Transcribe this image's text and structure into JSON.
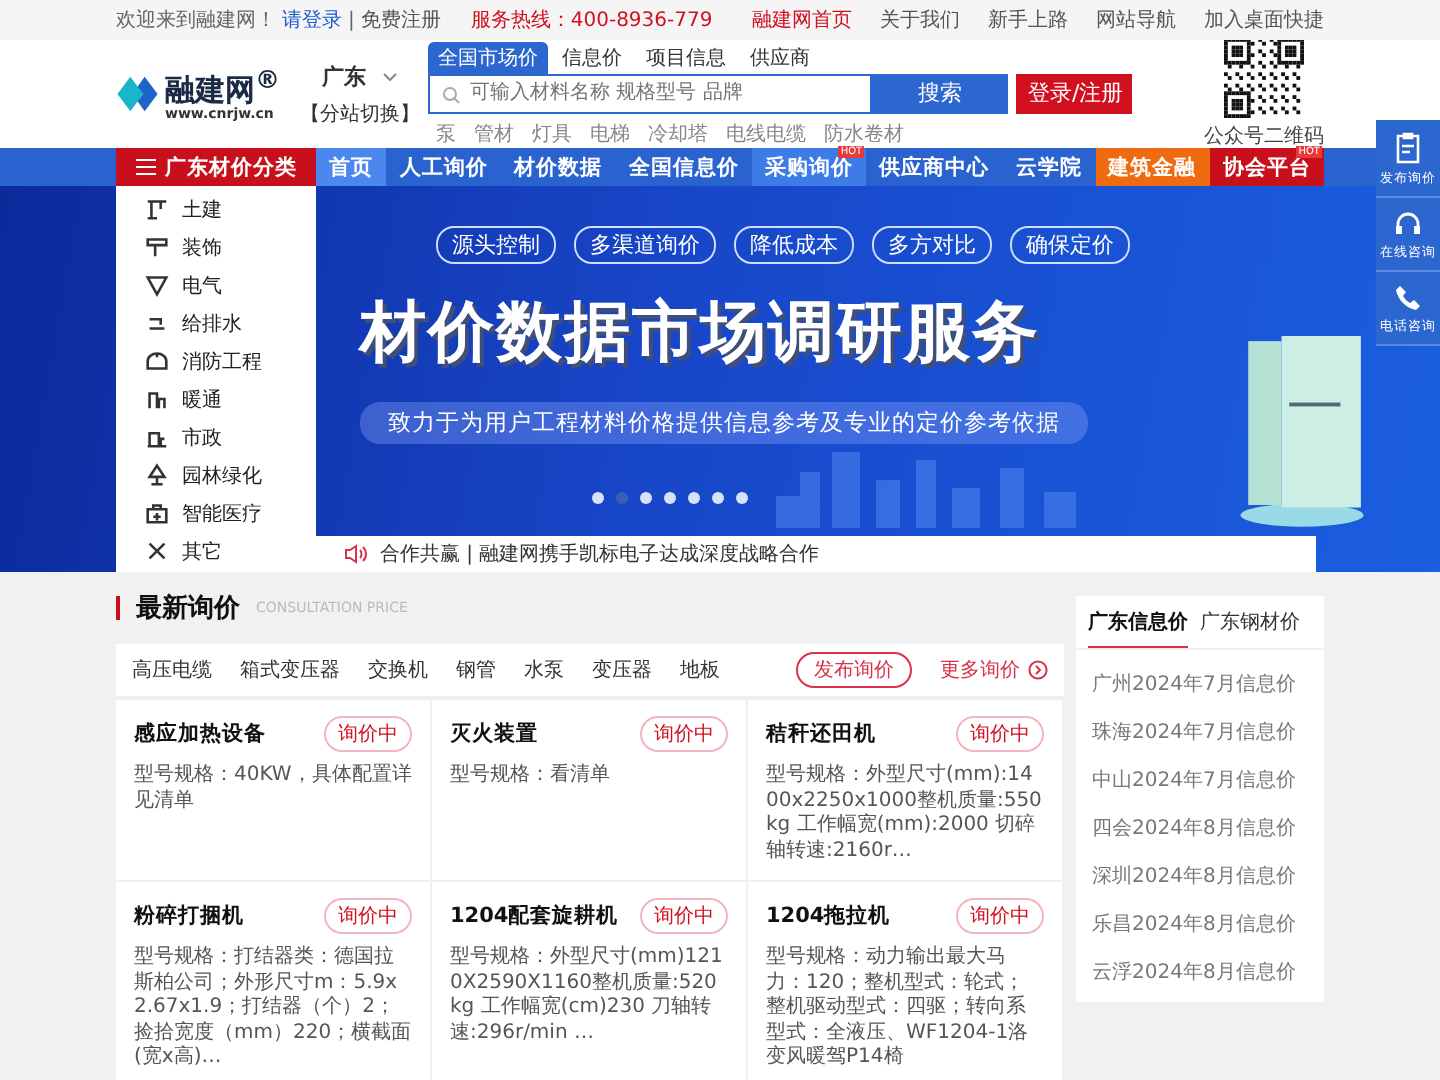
{
  "top_bar": {
    "welcome": "欢迎来到融建网！",
    "login_link": "请登录",
    "separator": "|",
    "register_link": "免费注册",
    "hotline": "服务热线：400-8936-779",
    "links": [
      {
        "label": "融建网首页",
        "selected": true
      },
      {
        "label": "关于我们",
        "selected": false
      },
      {
        "label": "新手上路",
        "selected": false
      },
      {
        "label": "网站导航",
        "selected": false
      },
      {
        "label": "加入桌面快捷",
        "selected": false
      }
    ]
  },
  "header": {
    "logo_name": "融建网$^{®}$",
    "logo_url": "www.cnrjw.cn",
    "city": "广东",
    "city_switch": "【分站切换】",
    "search_tabs": [
      {
        "label": "全国市场价",
        "selected": true
      },
      {
        "label": "信息价",
        "selected": false
      },
      {
        "label": "项目信息",
        "selected": false
      },
      {
        "label": "供应商",
        "selected": false
      }
    ],
    "search": {
      "placeholder": "可输入材料名称 规格型号 品牌"
    },
    "search_button": "搜索",
    "login_button": "登录/注册",
    "hot_keywords": [
      "泵",
      "管材",
      "灯具",
      "电梯",
      "冷却塔",
      "电线电缆",
      "防水卷材"
    ],
    "qr_caption": "公众号二维码"
  },
  "nav": {
    "category_button": "广东材价分类",
    "items": [
      {
        "label": "首页",
        "kind": "plain",
        "selected": true
      },
      {
        "label": "人工询价",
        "kind": "plain",
        "selected": false
      },
      {
        "label": "材价数据",
        "kind": "plain",
        "selected": false
      },
      {
        "label": "全国信息价",
        "kind": "plain",
        "selected": false
      },
      {
        "label": "采购询价",
        "kind": "light",
        "selected": false,
        "badge": "HOT"
      },
      {
        "label": "供应商中心",
        "kind": "plain",
        "selected": false
      },
      {
        "label": "云学院",
        "kind": "plain",
        "selected": false
      },
      {
        "label": "建筑金融",
        "kind": "orange",
        "selected": false
      },
      {
        "label": "协会平台",
        "kind": "red",
        "selected": false,
        "badge": "HOT"
      }
    ]
  },
  "sidebar": {
    "items": [
      "土建",
      "装饰",
      "电气",
      "给排水",
      "消防工程",
      "暖通",
      "市政",
      "园林绿化",
      "智能医疗",
      "其它"
    ]
  },
  "banner": {
    "pills": [
      "源头控制",
      "多渠道询价",
      "降低成本",
      "多方对比",
      "确保定价"
    ],
    "title": "材价数据市场调研服务",
    "subtitle": "致力于为用户工程材料价格提供信息参考及专业的定价参考依据",
    "dots": [
      {
        "selected": false
      },
      {
        "selected": true
      },
      {
        "selected": false
      },
      {
        "selected": false
      },
      {
        "selected": false
      },
      {
        "selected": false
      },
      {
        "selected": false
      }
    ]
  },
  "notice": {
    "text": "合作共赢 | 融建网携手凯标电子达成深度战略合作"
  },
  "inquiry": {
    "title": "最新询价",
    "subtitle": "CONSULTATION PRICE",
    "categories": [
      "高压电缆",
      "箱式变压器",
      "交换机",
      "钢管",
      "水泵",
      "变压器",
      "地板"
    ],
    "publish_button": "发布询价",
    "more_link": "更多询价",
    "items": [
      {
        "name": "感应加热设备",
        "status": "询价中",
        "spec": "型号规格：40KW，具体配置详见清单"
      },
      {
        "name": "灭火装置",
        "status": "询价中",
        "spec": "型号规格：看清单"
      },
      {
        "name": "秸秆还田机",
        "status": "询价中",
        "spec": "型号规格：外型尺寸(mm):1400x2250x1000整机质量:550 kg 工作幅宽(mm):2000 切碎轴转速:2160r…"
      },
      {
        "name": "粉碎打捆机",
        "status": "询价中",
        "spec": "型号规格：打结器类：德国拉斯柏公司；外形尺寸m：5.9x2.67x1.9；打结器（个）2；捡拾宽度（mm）220；横截面(宽x高)…"
      },
      {
        "name": "1204配套旋耕机",
        "status": "询价中",
        "spec": "型号规格：外型尺寸(mm)1210X2590X1160整机质量:520kg 工作幅宽(cm)230 刀轴转速:296r/min …"
      },
      {
        "name": "1204拖拉机",
        "status": "询价中",
        "spec": "型号规格：动力输出最大马力：120；整机型式：轮式；整机驱动型式：四驱；转向系型式：全液压、WF1204-1洛变风暖驾P14椅"
      }
    ]
  },
  "info_prices": {
    "tabs": [
      {
        "label": "广东信息价",
        "selected": true
      },
      {
        "label": "广东钢材价",
        "selected": false
      }
    ],
    "items": [
      "广州2024年7月信息价",
      "珠海2024年7月信息价",
      "中山2024年7月信息价",
      "四会2024年8月信息价",
      "深圳2024年8月信息价",
      "乐昌2024年8月信息价",
      "云浮2024年8月信息价"
    ]
  },
  "float_bar": {
    "buttons": [
      "发布询价",
      "在线咨询",
      "电话咨询"
    ]
  }
}
